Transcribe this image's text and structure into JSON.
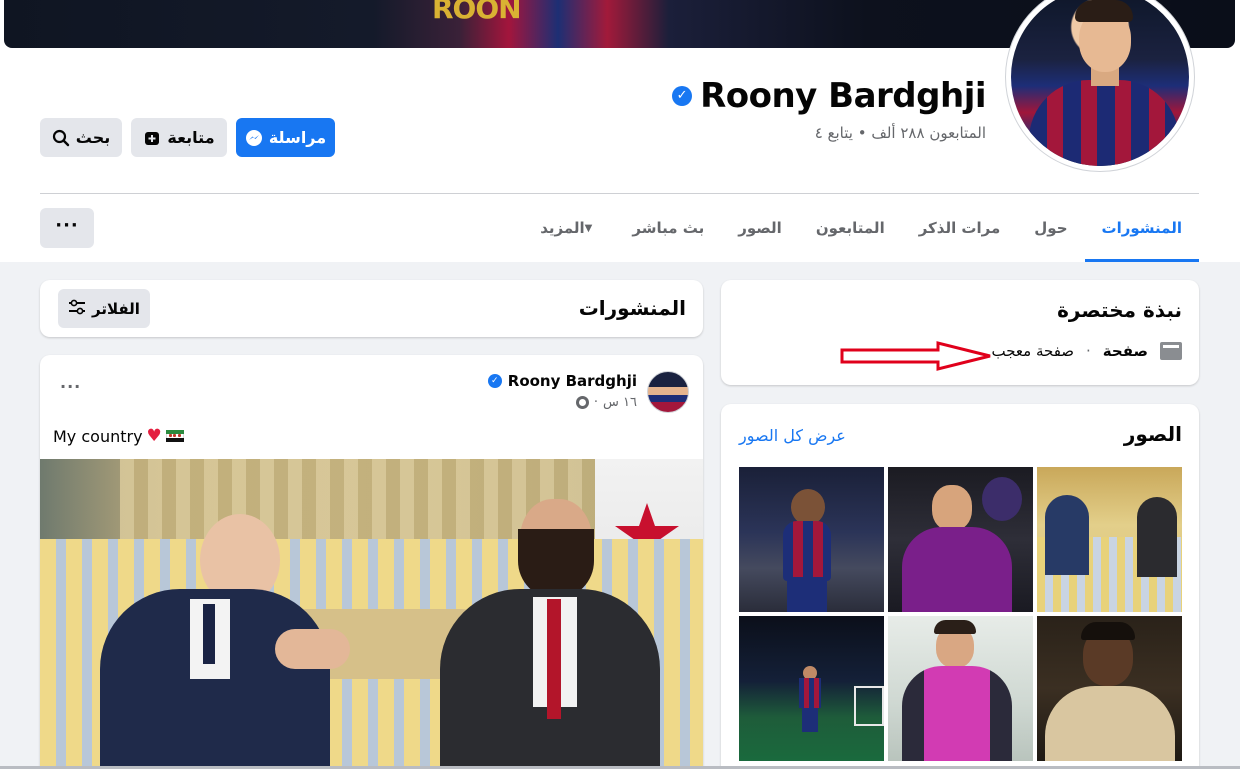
{
  "profile": {
    "name": "Roony Bardghji",
    "followers_line": "المتابعون ٢٨٨ ألف • يتابع ٤",
    "verified": true,
    "cover_text": "ROON"
  },
  "actions": {
    "message_label": "مراسلة",
    "follow_label": "متابعة",
    "search_label": "بحث"
  },
  "tabs": [
    {
      "label": "المنشورات",
      "active": true
    },
    {
      "label": "حول",
      "active": false
    },
    {
      "label": "مرات الذكر",
      "active": false
    },
    {
      "label": "المتابعون",
      "active": false
    },
    {
      "label": "الصور",
      "active": false
    },
    {
      "label": "بث مباشر",
      "active": false
    },
    {
      "label": "المزيد",
      "active": false
    }
  ],
  "more_button": "···",
  "intro": {
    "title": "نبذة مختصرة",
    "kind": "صفحة",
    "separator": "·",
    "category": "صفحة معجب"
  },
  "photos": {
    "title": "الصور",
    "see_all": "عرض كل الصور"
  },
  "posts_header": {
    "title": "المنشورات",
    "filters_label": "الفلاتر"
  },
  "post": {
    "author": "Roony Bardghji",
    "time": "١٦ س",
    "separator": "·",
    "text": "My country",
    "menu": "···"
  },
  "colors": {
    "accent": "#1877f2",
    "annotation": "#e0001b",
    "background": "#f0f2f5"
  },
  "icons": {
    "messenger": "messenger-icon",
    "follow": "follow-icon",
    "search": "search-icon",
    "filters": "sliders-icon",
    "page": "flag-icon",
    "privacy": "globe-icon"
  }
}
